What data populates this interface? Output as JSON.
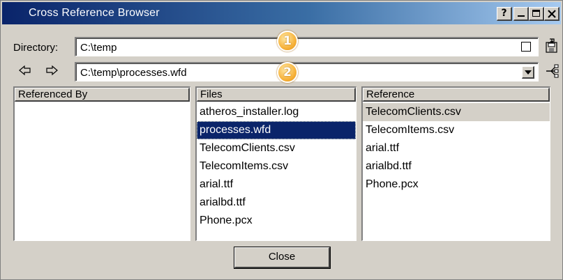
{
  "window": {
    "title": "Cross Reference Browser",
    "controls": {
      "help": "?"
    }
  },
  "directory": {
    "label": "Directory:",
    "value": "C:\\temp"
  },
  "file_path": {
    "value": "C:\\temp\\processes.wfd"
  },
  "callouts": [
    "1",
    "2"
  ],
  "columns": {
    "referenced_by": {
      "header": "Referenced By",
      "items": []
    },
    "files": {
      "header": "Files",
      "items": [
        "atheros_installer.log",
        "processes.wfd",
        "TelecomClients.csv",
        "TelecomItems.csv",
        "arial.ttf",
        "arialbd.ttf",
        "Phone.pcx"
      ],
      "selected": "processes.wfd"
    },
    "reference": {
      "header": "Reference",
      "items": [
        "TelecomClients.csv",
        "TelecomItems.csv",
        "arial.ttf",
        "arialbd.ttf",
        "Phone.pcx"
      ],
      "highlighted": "TelecomClients.csv"
    }
  },
  "buttons": {
    "close": "Close"
  },
  "colors": {
    "titlebar_start": "#0a246a",
    "titlebar_end": "#a6caf0",
    "face": "#d4d0c8",
    "selection": "#0a246a",
    "callout": "#f7b33b"
  },
  "icons": [
    "help-icon",
    "minimize-icon",
    "maximize-icon",
    "close-icon",
    "back-arrow-icon",
    "forward-arrow-icon",
    "save-icon",
    "browse-icon",
    "dropdown-arrow-icon",
    "tree-icon"
  ]
}
